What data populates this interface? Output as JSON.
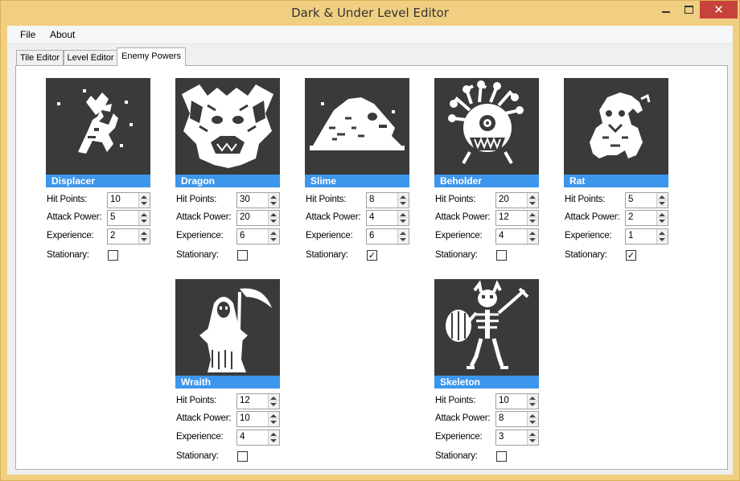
{
  "window": {
    "title": "Dark & Under Level Editor",
    "close_glyph": "✕"
  },
  "menu": {
    "file": "File",
    "about": "About"
  },
  "tabs": [
    {
      "label": "Tile Editor",
      "active": false
    },
    {
      "label": "Level Editor",
      "active": false
    },
    {
      "label": "Enemy Powers",
      "active": true
    }
  ],
  "field_labels": {
    "hit_points": "Hit Points:",
    "attack_power": "Attack Power:",
    "experience": "Experience:",
    "stationary": "Stationary:"
  },
  "checkmark": "✓",
  "colors": {
    "accent": "#3c96eb",
    "portrait_bg": "#3a3a3a",
    "close": "#c7423a",
    "frame": "#f0cf82"
  },
  "enemies": [
    {
      "name": "Displacer",
      "icon": "displacer-icon",
      "hit_points": "10",
      "attack_power": "5",
      "experience": "2",
      "stationary": false
    },
    {
      "name": "Dragon",
      "icon": "dragon-icon",
      "hit_points": "30",
      "attack_power": "20",
      "experience": "6",
      "stationary": false
    },
    {
      "name": "Slime",
      "icon": "slime-icon",
      "hit_points": "8",
      "attack_power": "4",
      "experience": "6",
      "stationary": true
    },
    {
      "name": "Beholder",
      "icon": "beholder-icon",
      "hit_points": "20",
      "attack_power": "12",
      "experience": "4",
      "stationary": false
    },
    {
      "name": "Rat",
      "icon": "rat-icon",
      "hit_points": "5",
      "attack_power": "2",
      "experience": "1",
      "stationary": true
    },
    {
      "name": "Wraith",
      "icon": "wraith-icon",
      "hit_points": "12",
      "attack_power": "10",
      "experience": "4",
      "stationary": false
    },
    {
      "name": "Skeleton",
      "icon": "skeleton-icon",
      "hit_points": "10",
      "attack_power": "8",
      "experience": "3",
      "stationary": false
    }
  ]
}
